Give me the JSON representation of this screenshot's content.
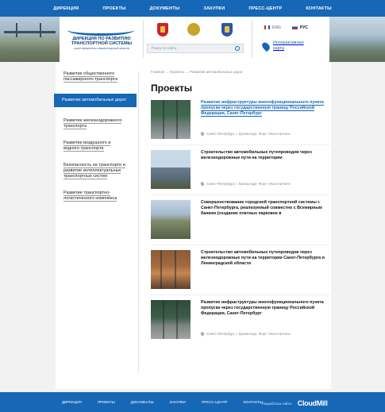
{
  "topnav": [
    "ДИРЕКЦИЯ",
    "ПРОЕКТЫ",
    "ДОКУМЕНТЫ",
    "ЗАКУПКИ",
    "ПРЕСС-ЦЕНТР",
    "КОНТАКТЫ"
  ],
  "logo": {
    "title": "ДИРЕКЦИЯ ПО РАЗВИТИЮ ТРАНСПОРТНОЙ СИСТЕМЫ",
    "subtitle": "САНКТ-ПЕТЕРБУРГА И ЛЕНИНГРАДСКОЙ ОБЛАСТИ"
  },
  "search": {
    "placeholder": "Поиск по сайту"
  },
  "lang": {
    "en": "ENG",
    "ru": "РУС"
  },
  "map_link": "Интерактивная карта",
  "sidebar": [
    "Развитие общественного пассажирского транспорта",
    "Развитие автомобильных дорог",
    "Развитие железнодорожного транспорта",
    "Развитие воздушного и водного транспорта",
    "Безопасность на транспорте и развитие интеллектуальных транспортных систем",
    "Развитие транспортно-логистического комплекса"
  ],
  "breadcrumb": "Главная → Проекты → Развитие автомобильных дорог",
  "page_title": "Проекты",
  "projects": [
    {
      "title": "Развитие инфраструктуры многофункционального пункта пропуска через государственную границу Российской Федерации, Санкт-Петербург",
      "location": "Санкт-Петербург, г. Кронштадт, Форт «Константин»"
    },
    {
      "title": "Строительство автомобильных путепроводов через железнодорожные пути на территории",
      "location": "Санкт-Петербург, г. Кронштадт, Форт «Константин»"
    },
    {
      "title": "Совершенствование городской транспортной системы г. Санкт-Петербурга, реализуемый совместно с Всемирным банком (создание платных парковок в",
      "location": ""
    },
    {
      "title": "Строительство автомобильных путепроводов через железнодорожные пути на территории Санкт-Петербурга и Ленинградской области",
      "location": ""
    },
    {
      "title": "Развитие инфраструктуры многофункционального пункта пропуска через государственную границу Российской Федерации, Санкт-Петербург",
      "location": "Санкт-Петербург, г. Кронштадт, Форт «Константин»"
    }
  ],
  "footer": {
    "nav": [
      "ДИРЕКЦИЯ",
      "ПРОЕКТЫ",
      "ДОКУМЕНТЫ",
      "ЗАКУПКИ",
      "ПРЕСС-ЦЕНТР",
      "КОНТАКТЫ"
    ],
    "developer_label": "Разработка сайта -",
    "developer_name": "CloudMill"
  }
}
